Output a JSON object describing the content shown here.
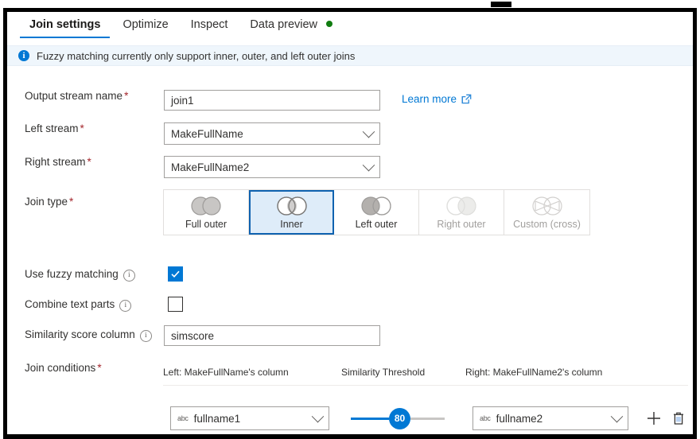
{
  "window": {
    "frame_color": "#000000"
  },
  "tabs": [
    {
      "label": "Join settings",
      "active": true,
      "dot": false
    },
    {
      "label": "Optimize",
      "active": false,
      "dot": false
    },
    {
      "label": "Inspect",
      "active": false,
      "dot": false
    },
    {
      "label": "Data preview",
      "active": false,
      "dot": true,
      "dot_color": "#107c10"
    }
  ],
  "info_bar": {
    "icon": "info-icon",
    "message": "Fuzzy matching currently only support inner, outer, and left outer joins",
    "background": "#eff6fc",
    "accent": "#0078d4"
  },
  "form": {
    "output_stream": {
      "label": "Output stream name",
      "required": "*",
      "value": "join1",
      "placeholder": "Output stream name"
    },
    "left_stream": {
      "label": "Left stream",
      "required": "*",
      "value": "MakeFullName"
    },
    "right_stream": {
      "label": "Right stream",
      "required": "*",
      "value": "MakeFullName2"
    },
    "learn_more": {
      "label": "Learn more",
      "icon": "external-link-icon",
      "color": "#0078d4"
    },
    "join_type": {
      "label": "Join type",
      "required": "*",
      "selected": "Inner",
      "selected_color": "#deecf9",
      "selected_border": "#0f62b0",
      "options": [
        {
          "label": "Full outer",
          "icon": "venn-full-outer-icon",
          "disabled": false
        },
        {
          "label": "Inner",
          "icon": "venn-inner-icon",
          "disabled": false
        },
        {
          "label": "Left outer",
          "icon": "venn-left-outer-icon",
          "disabled": false
        },
        {
          "label": "Right outer",
          "icon": "venn-right-outer-icon",
          "disabled": true
        },
        {
          "label": "Custom (cross)",
          "icon": "venn-cross-icon",
          "disabled": true
        }
      ]
    },
    "use_fuzzy_matching": {
      "label": "Use fuzzy matching",
      "info": "info-circle-icon",
      "checked": true
    },
    "combine_text_parts": {
      "label": "Combine text parts",
      "info": "info-circle-icon",
      "checked": false
    },
    "similarity_score_column": {
      "label": "Similarity score column",
      "info": "info-circle-icon",
      "value": "simscore",
      "placeholder": "Similarity score column"
    },
    "join_conditions": {
      "label": "Join conditions",
      "required": "*",
      "headers": {
        "left": "Left: MakeFullName's column",
        "threshold": "Similarity Threshold",
        "right": "Right: MakeFullName2's column"
      },
      "rows": [
        {
          "left_type_icon": "abc-string-type-icon",
          "left_value": "fullname1",
          "threshold": "80",
          "threshold_percent": 60,
          "right_type_icon": "abc-string-type-icon",
          "right_value": "fullname2",
          "add_icon": "plus-icon",
          "delete_icon": "trash-icon"
        }
      ]
    }
  }
}
